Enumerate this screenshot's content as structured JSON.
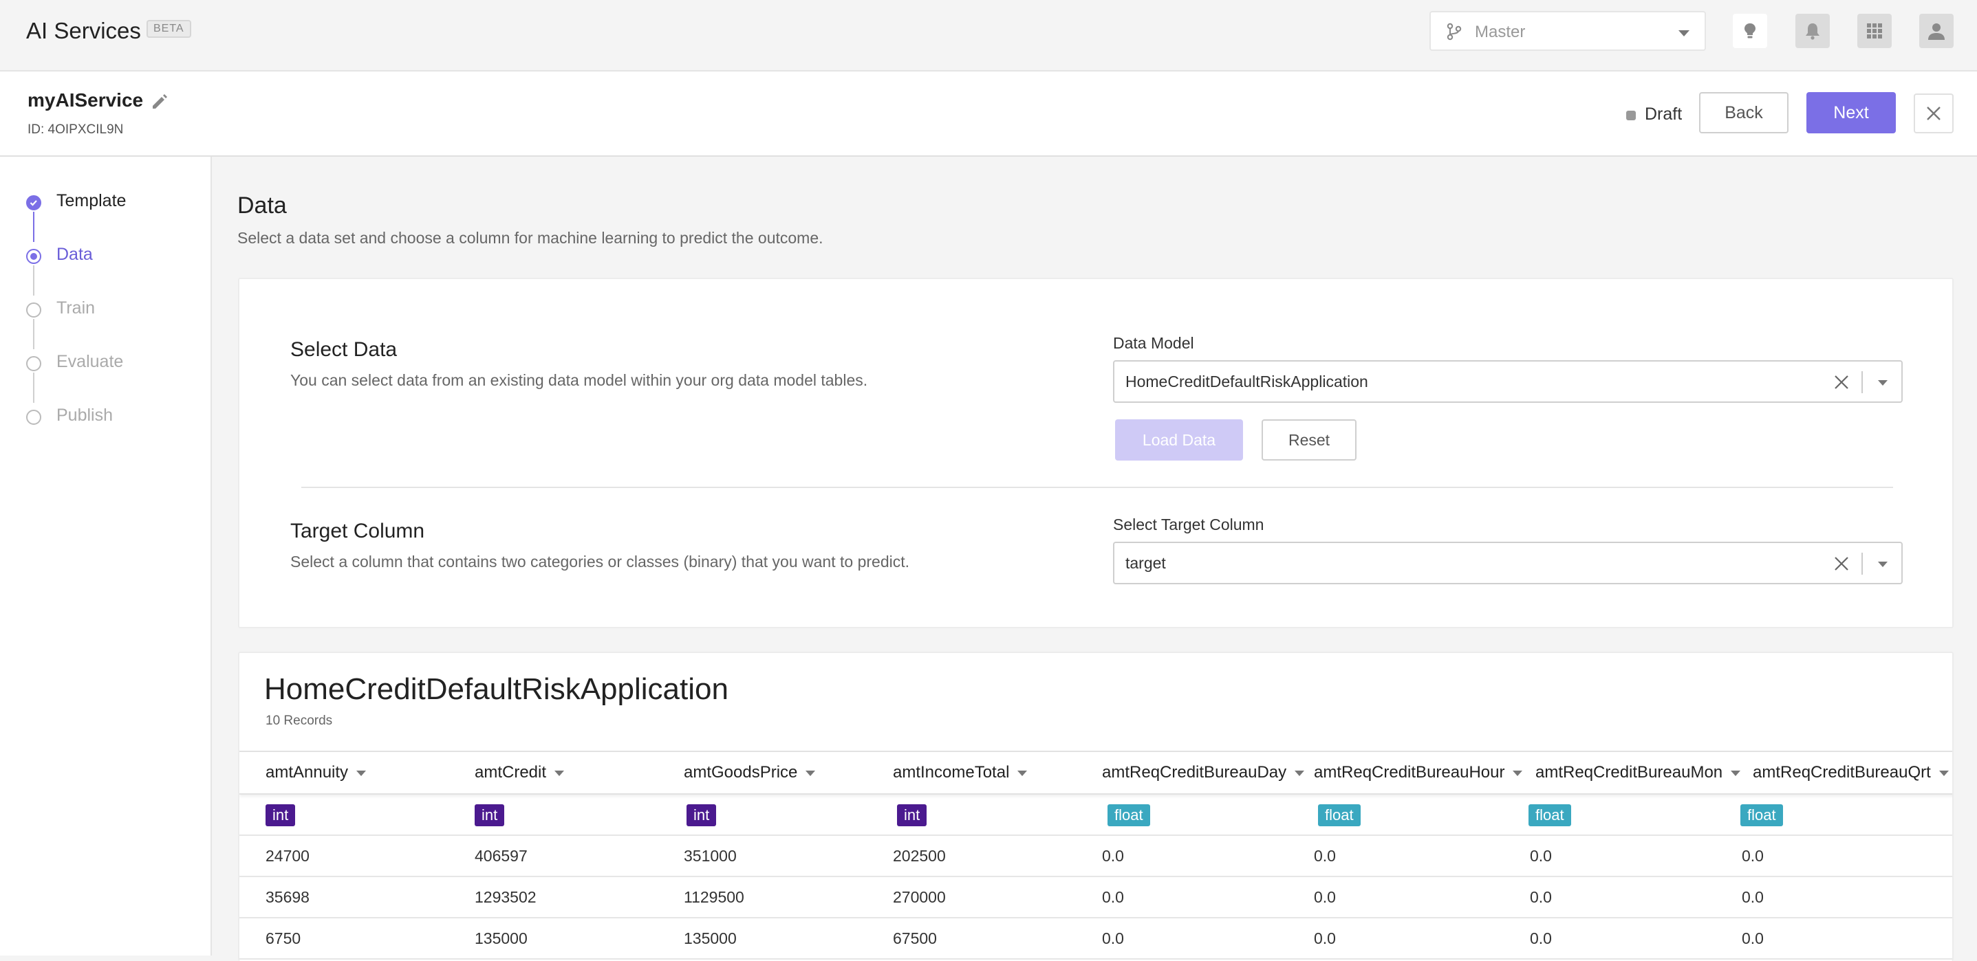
{
  "app": {
    "title": "AI Services",
    "badge": "BETA"
  },
  "branch": {
    "label": "Master",
    "icon": "branch-icon"
  },
  "header_icons": [
    "lightbulb-icon",
    "bell-icon",
    "apps-grid-icon",
    "user-icon"
  ],
  "service": {
    "name": "myAIService",
    "id": "ID: 4OIPXCIL9N"
  },
  "status": {
    "label": "Draft"
  },
  "actions": {
    "back": "Back",
    "next": "Next"
  },
  "steps": [
    {
      "label": "Template",
      "state": "done"
    },
    {
      "label": "Data",
      "state": "active"
    },
    {
      "label": "Train",
      "state": "pending"
    },
    {
      "label": "Evaluate",
      "state": "pending"
    },
    {
      "label": "Publish",
      "state": "pending"
    }
  ],
  "page": {
    "title": "Data",
    "subtitle": "Select a data set and choose a column for machine learning to predict the outcome."
  },
  "select_data": {
    "title": "Select Data",
    "description": "You can select data from an existing data model within your org data model tables.",
    "field_label": "Data Model",
    "value": "HomeCreditDefaultRiskApplication",
    "load_button": "Load Data",
    "reset_button": "Reset"
  },
  "target_column": {
    "title": "Target Column",
    "description": "Select a column that contains two categories or classes (binary) that you want to predict.",
    "field_label": "Select Target Column",
    "value": "target"
  },
  "table": {
    "title": "HomeCreditDefaultRiskApplication",
    "records": "10 Records",
    "columns": [
      {
        "name": "amtAnnuity",
        "type": "int"
      },
      {
        "name": "amtCredit",
        "type": "int"
      },
      {
        "name": "amtGoodsPrice",
        "type": "int"
      },
      {
        "name": "amtIncomeTotal",
        "type": "int"
      },
      {
        "name": "amtReqCreditBureauDay",
        "type": "float"
      },
      {
        "name": "amtReqCreditBureauHour",
        "type": "float"
      },
      {
        "name": "amtReqCreditBureauMon",
        "type": "float"
      },
      {
        "name": "amtReqCreditBureauQrt",
        "type": "float"
      }
    ],
    "rows": [
      [
        "24700",
        "406597",
        "351000",
        "202500",
        "0.0",
        "0.0",
        "0.0",
        "0.0"
      ],
      [
        "35698",
        "1293502",
        "1129500",
        "270000",
        "0.0",
        "0.0",
        "0.0",
        "0.0"
      ],
      [
        "6750",
        "135000",
        "135000",
        "67500",
        "0.0",
        "0.0",
        "0.0",
        "0.0"
      ]
    ]
  }
}
